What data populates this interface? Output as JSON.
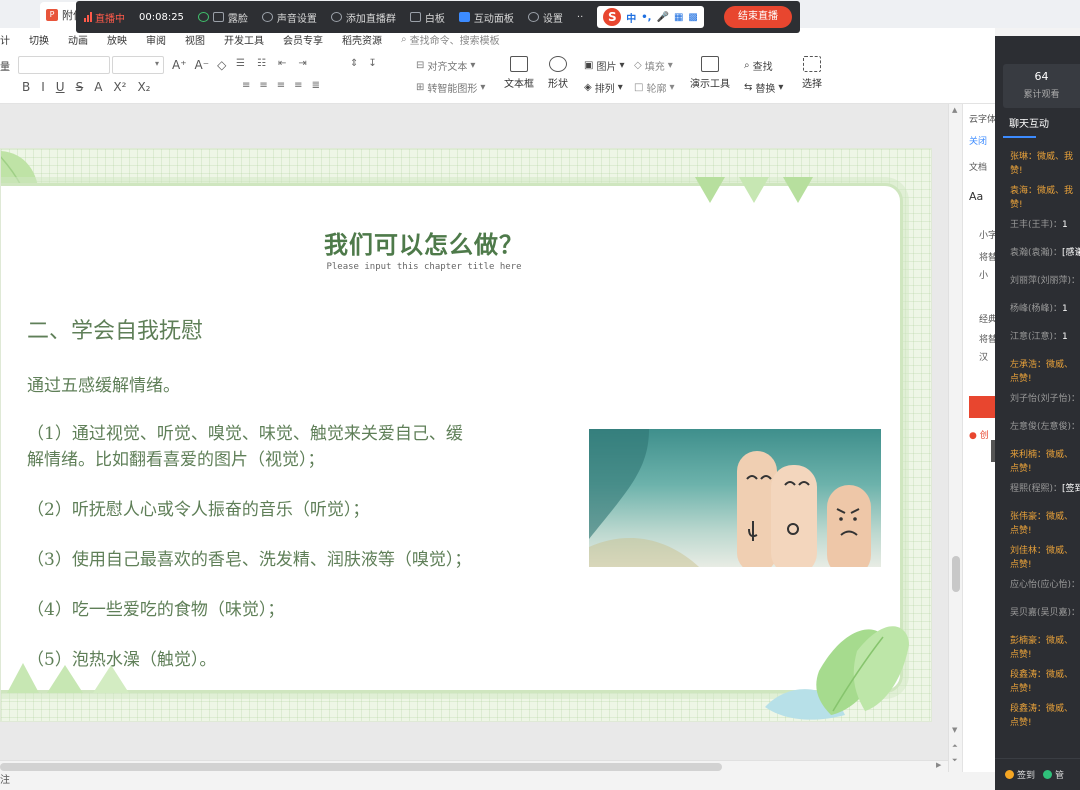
{
  "titlebar": {
    "doc_tab": "附件"
  },
  "livebar": {
    "live_label": "直播中",
    "timer": "00:08:25",
    "items": [
      "露脸",
      "声音设置",
      "添加直播群",
      "白板",
      "互动面板",
      "设置"
    ],
    "more": "··",
    "ime": {
      "logo": "S",
      "lang": "中",
      "punct": "•,",
      "mic": "🎤"
    },
    "end_label": "结束直播"
  },
  "menu": {
    "items": [
      "计",
      "切换",
      "动画",
      "放映",
      "审阅",
      "视图",
      "开发工具",
      "会员专享",
      "稻壳资源"
    ],
    "search": "查找命令、搜索模板"
  },
  "ribbon": {
    "font_letter": "量",
    "format_row1": [
      "A⁺",
      "A⁻",
      "◇"
    ],
    "format_row2": [
      "B",
      "I",
      "U",
      "S",
      "A",
      "X²",
      "X₂"
    ],
    "align_text": "对齐文本",
    "smart_art": "转智能图形",
    "textbox": "文本框",
    "shape": "形状",
    "picture": "图片",
    "fill": "填充",
    "arrange": "排列",
    "outline": "轮廓",
    "present_tools": "演示工具",
    "find": "查找",
    "replace": "替换",
    "select": "选择"
  },
  "slide": {
    "title": "我们可以怎么做？",
    "subtitle": "Please input this chapter title here",
    "heading": "二、学会自我抚慰",
    "intro": "通过五感缓解情绪。",
    "item1_line1": "（1）通过视觉、听觉、嗅觉、味觉、触觉来关爱自己、缓",
    "item1_line2": "解情绪。比如翻看喜爱的图片（视觉）；",
    "item2": "（2）听抚慰人心或令人振奋的音乐（听觉）；",
    "item3": "（3）使用自己最喜欢的香皂、洗发精、润肤液等（嗅觉）；",
    "item4": "（4）吃一些爱吃的食物（味觉）；",
    "item5": "（5）泡热水澡（触觉）。"
  },
  "right_pane": {
    "labels": [
      "云字体",
      "关闭",
      "文档",
      "Aa",
      "小字",
      "将替",
      "小",
      "经典",
      "将替",
      "汉",
      "创"
    ]
  },
  "status": {
    "text": "注"
  },
  "chat": {
    "viewer_count": "64",
    "viewer_label": "累计观看",
    "tab_label": "聊天互动",
    "messages": [
      {
        "name": "张琳：",
        "text": "微威、我",
        "line2": "赞!",
        "style": "orange"
      },
      {
        "name": "袁海：",
        "text": "微威、我",
        "line2": "赞!",
        "style": "orange"
      },
      {
        "name": "王丰(王丰)：",
        "text": "1",
        "line2": "",
        "style": "grey"
      },
      {
        "name": "袁瀚(袁瀚)：",
        "text": "[感谢",
        "line2": "",
        "style": "grey"
      },
      {
        "name": "刘丽萍(刘丽萍)：",
        "text": "",
        "line2": "",
        "style": "grey"
      },
      {
        "name": "杨峰(杨峰)：",
        "text": "1",
        "line2": "",
        "style": "grey"
      },
      {
        "name": "江意(江意)：",
        "text": "1",
        "line2": "",
        "style": "grey"
      },
      {
        "name": "左承浩：",
        "text": "微威、",
        "line2": "点赞!",
        "style": "orange"
      },
      {
        "name": "刘子怡(刘子怡)：",
        "text": "",
        "line2": "",
        "style": "grey"
      },
      {
        "name": "左意俊(左意俊)：",
        "text": "",
        "line2": "",
        "style": "grey"
      },
      {
        "name": "来利楠：",
        "text": "微威、",
        "line2": "点赞!",
        "style": "orange"
      },
      {
        "name": "程熙(程熙)：",
        "text": "[签到",
        "line2": "",
        "style": "grey"
      },
      {
        "name": "张伟豪：",
        "text": "微威、",
        "line2": "点赞!",
        "style": "orange"
      },
      {
        "name": "刘佳林：",
        "text": "微威、",
        "line2": "点赞!",
        "style": "orange"
      },
      {
        "name": "应心怡(应心怡)：",
        "text": "",
        "line2": "",
        "style": "grey"
      },
      {
        "name": "吴贝嘉(吴贝嘉)：",
        "text": "",
        "line2": "",
        "style": "grey"
      },
      {
        "name": "彭楠豪：",
        "text": "微威、",
        "line2": "点赞!",
        "style": "orange"
      },
      {
        "name": "段鑫涛：",
        "text": "微威、",
        "line2": "点赞!",
        "style": "orange"
      },
      {
        "name": "段鑫涛：",
        "text": "微威、",
        "line2": "点赞!",
        "style": "orange"
      }
    ],
    "bottom": {
      "checkin": "签到",
      "other": "管"
    }
  },
  "colors": {
    "accent_green": "#4e7a4a",
    "live_red": "#e8462f",
    "chat_bg": "#2c2e33",
    "name_orange": "#e8a13a"
  }
}
